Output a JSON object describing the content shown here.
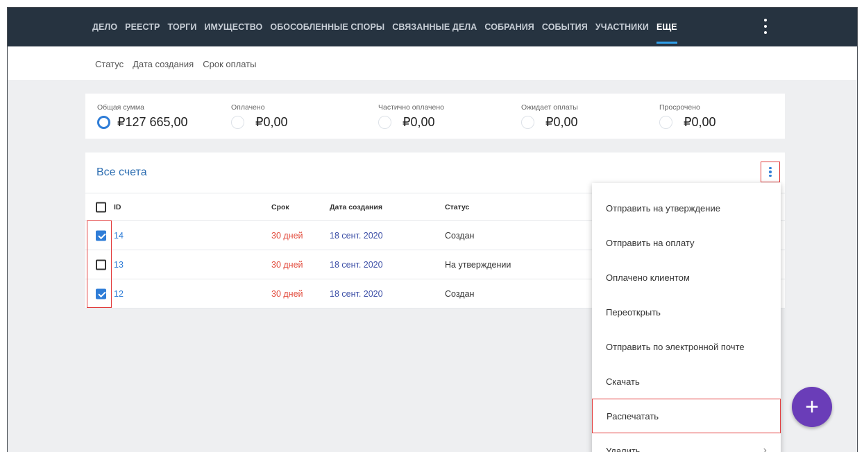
{
  "topnav": {
    "items": [
      "ДЕЛО",
      "РЕЕСТР",
      "ТОРГИ",
      "ИМУЩЕСТВО",
      "ОБОСОБЛЕННЫЕ СПОРЫ",
      "СВЯЗАННЫЕ ДЕЛА",
      "СОБРАНИЯ",
      "СОБЫТИЯ",
      "УЧАСТНИКИ",
      "ЕЩЕ"
    ],
    "active": "ЕЩЕ",
    "more_icon": "kebab-vertical-icon"
  },
  "subnav": {
    "items": [
      "Статус",
      "Дата создания",
      "Срок оплаты"
    ]
  },
  "summary": {
    "blocks": [
      {
        "label": "Общая сумма",
        "value": "₽127 665,00"
      },
      {
        "label": "Оплачено",
        "value": "₽0,00"
      },
      {
        "label": "Частично оплачено",
        "value": "₽0,00"
      },
      {
        "label": "Ожидает оплаты",
        "value": "₽0,00"
      },
      {
        "label": "Просрочено",
        "value": "₽0,00"
      }
    ],
    "accent_color": "#2f7dd7"
  },
  "invoices": {
    "title": "Все счета",
    "columns": {
      "id": "ID",
      "srok": "Срок",
      "date": "Дата создания",
      "status": "Статус"
    },
    "rows": [
      {
        "checked": true,
        "id": "14",
        "srok": "30 дней",
        "date": "18 сент. 2020",
        "status": "Создан"
      },
      {
        "checked": false,
        "id": "13",
        "srok": "30 дней",
        "date": "18 сент. 2020",
        "status": "На утверждении"
      },
      {
        "checked": true,
        "id": "12",
        "srok": "30 дней",
        "date": "18 сент. 2020",
        "status": "Создан"
      }
    ]
  },
  "menu": {
    "items": [
      "Отправить на утверждение",
      "Отправить на оплату",
      "Оплачено клиентом",
      "Переоткрыть",
      "Отправить по электронной почте",
      "Скачать",
      "Распечатать",
      "Удалить"
    ],
    "highlighted": "Распечатать"
  },
  "fab": {
    "label": "+"
  },
  "colors": {
    "nav_bg": "#263340",
    "link_blue": "#2f7dd7",
    "due_red": "#e24a3b",
    "fab_purple": "#6a3db8",
    "highlight_red": "#e23b3b"
  }
}
